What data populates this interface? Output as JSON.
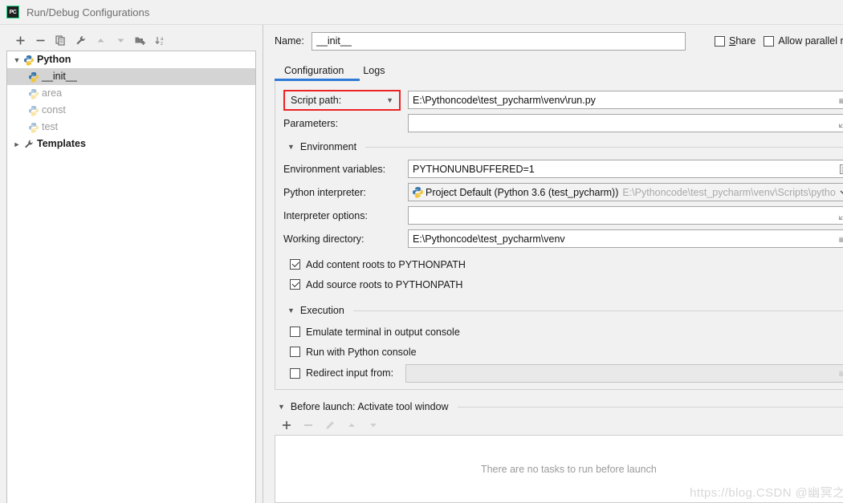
{
  "window": {
    "title": "Run/Debug Configurations",
    "logo_text": "PC"
  },
  "sidebar": {
    "toolbar": [
      {
        "name": "add-configuration-button",
        "icon": "plus-icon",
        "tooltip": "Add New Configuration"
      },
      {
        "name": "remove-configuration-button",
        "icon": "minus-icon",
        "tooltip": "Remove Configuration"
      },
      {
        "name": "copy-configuration-button",
        "icon": "copy-icon",
        "tooltip": "Copy Configuration"
      },
      {
        "name": "edit-templates-button",
        "icon": "wrench-icon",
        "tooltip": "Edit Templates"
      },
      {
        "name": "move-up-button",
        "icon": "arrow-up-icon",
        "tooltip": "Move Up"
      },
      {
        "name": "move-down-button",
        "icon": "arrow-down-icon",
        "tooltip": "Move Down"
      },
      {
        "name": "create-folder-button",
        "icon": "folder-add-icon",
        "tooltip": "Create New Folder"
      },
      {
        "name": "sort-configurations-button",
        "icon": "sort-alpha-icon",
        "tooltip": "Sort Configurations"
      }
    ],
    "tree": [
      {
        "label": "Python",
        "level": 0,
        "expanded": true,
        "icon": "python-icon",
        "bold": true,
        "dim": false,
        "selected": false
      },
      {
        "label": "__init__",
        "level": 1,
        "expanded": null,
        "icon": "python-icon",
        "bold": false,
        "dim": false,
        "selected": true
      },
      {
        "label": "area",
        "level": 1,
        "expanded": null,
        "icon": "python-icon",
        "bold": false,
        "dim": true,
        "selected": false
      },
      {
        "label": "const",
        "level": 1,
        "expanded": null,
        "icon": "python-icon",
        "bold": false,
        "dim": true,
        "selected": false
      },
      {
        "label": "test",
        "level": 1,
        "expanded": null,
        "icon": "python-icon",
        "bold": false,
        "dim": true,
        "selected": false
      },
      {
        "label": "Templates",
        "level": 0,
        "expanded": false,
        "icon": "wrench-icon",
        "bold": true,
        "dim": false,
        "selected": false
      }
    ]
  },
  "header": {
    "name_label": "Name:",
    "name_value": "__init__",
    "share_label": "Share",
    "share_accel": "S",
    "share_checked": false,
    "parallel_label": "Allow parallel r",
    "parallel_checked": false
  },
  "tabs": [
    {
      "label": "Configuration",
      "active": true
    },
    {
      "label": "Logs",
      "active": false
    }
  ],
  "form": {
    "script_path_combo": "Script path:",
    "script_path_value": "E:\\Pythoncode\\test_pycharm\\venv\\run.py",
    "parameters_label": "Parameters:",
    "parameters_value": "",
    "environment_section": "Environment",
    "env_vars_label": "Environment variables:",
    "env_vars_value": "PYTHONUNBUFFERED=1",
    "interpreter_label": "Python interpreter:",
    "interpreter_value": "Project Default (Python 3.6 (test_pycharm))",
    "interpreter_path": "E:\\Pythoncode\\test_pycharm\\venv\\Scripts\\pytho",
    "interpreter_options_label": "Interpreter options:",
    "interpreter_options_value": "",
    "working_dir_label": "Working directory:",
    "working_dir_value": "E:\\Pythoncode\\test_pycharm\\venv",
    "add_content_roots_label": "Add content roots to PYTHONPATH",
    "add_content_roots_checked": true,
    "add_source_roots_label": "Add source roots to PYTHONPATH",
    "add_source_roots_checked": true,
    "execution_section": "Execution",
    "emulate_terminal_label": "Emulate terminal in output console",
    "emulate_terminal_checked": false,
    "run_with_console_label": "Run with Python console",
    "run_with_console_checked": false,
    "redirect_input_label": "Redirect input from:",
    "redirect_input_checked": false,
    "redirect_input_value": ""
  },
  "before_launch": {
    "header": "Before launch: Activate tool window",
    "toolbar": [
      {
        "name": "add-task-button",
        "icon": "plus-icon",
        "enabled": true
      },
      {
        "name": "remove-task-button",
        "icon": "minus-icon",
        "enabled": false
      },
      {
        "name": "edit-task-button",
        "icon": "pencil-icon",
        "enabled": false
      },
      {
        "name": "task-move-up-button",
        "icon": "arrow-up-icon",
        "enabled": false
      },
      {
        "name": "task-move-down-button",
        "icon": "arrow-down-icon",
        "enabled": false
      }
    ],
    "empty_text": "There are no tasks to run before launch"
  },
  "watermark": "https://blog.CSDN @幽冥之花",
  "colors": {
    "accent_tab": "#2f7ad6",
    "highlight_box": "#ee2222",
    "selection": "#d4d4d4",
    "panel_bg": "#f1f1f1"
  }
}
